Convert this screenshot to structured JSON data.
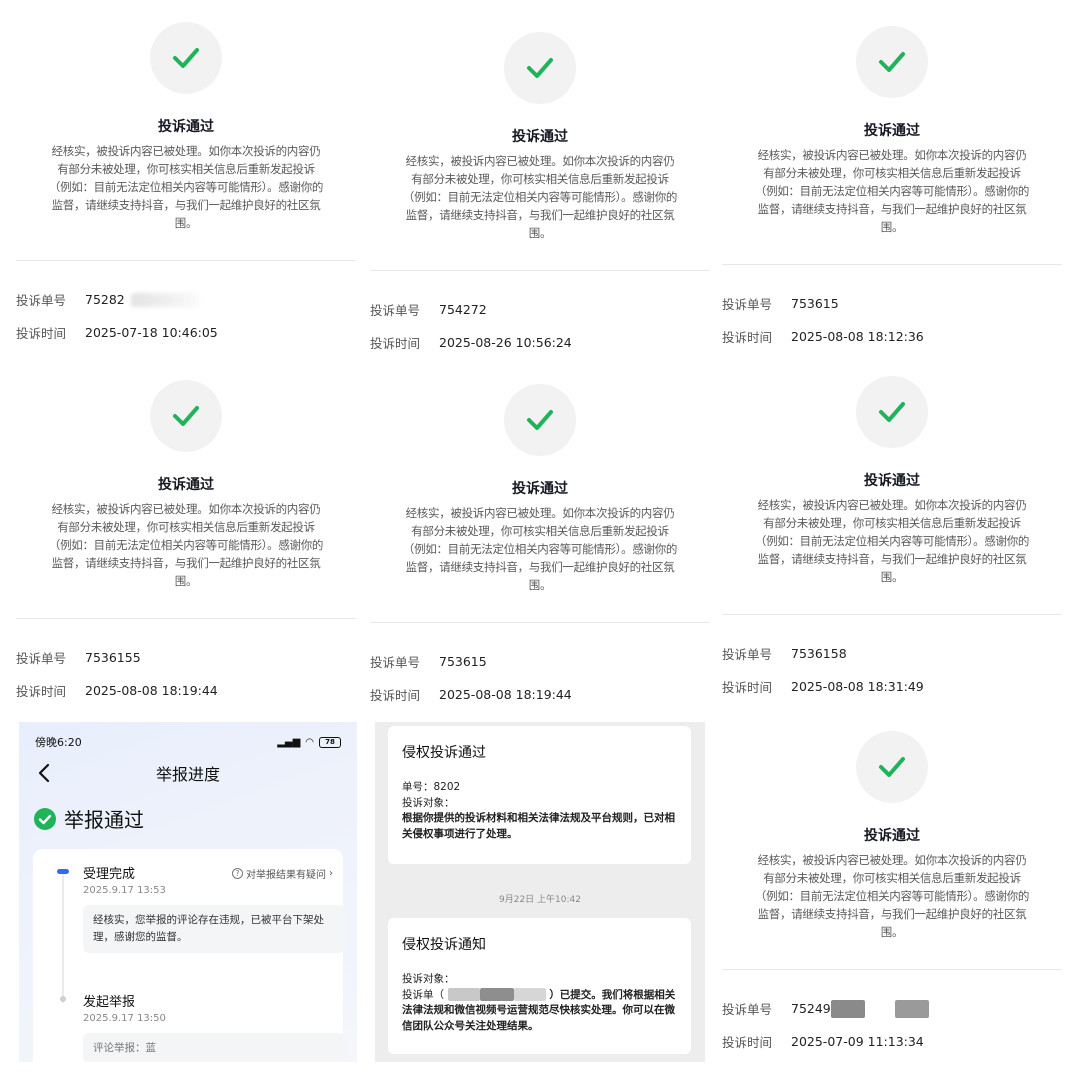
{
  "complaint_cards": [
    {
      "title": "投诉通过",
      "desc_lines": [
        "经核实，被投诉内容已被处理。如你本次投诉的内容仍",
        "有部分未被处理，你可核实相关信息后重新发起投诉",
        "（例如：目前无法定位相关内容等可能情形）。感谢你的",
        "监督，请继续支持抖音，与我们一起维护良好的社区氛",
        "围。"
      ],
      "id_label": "投诉单号",
      "id_value": "75282",
      "time_label": "投诉时间",
      "time_value": "2025-07-18 10:46:05"
    },
    {
      "title": "投诉通过",
      "desc_lines": [
        "经核实，被投诉内容已被处理。如你本次投诉的内容仍",
        "有部分未被处理，你可核实相关信息后重新发起投诉",
        "（例如：目前无法定位相关内容等可能情形）。感谢你的",
        "监督，请继续支持抖音，与我们一起维护良好的社区氛",
        "围。"
      ],
      "id_label": "投诉单号",
      "id_value": "754272",
      "time_label": "投诉时间",
      "time_value": "2025-08-26 10:56:24"
    },
    {
      "title": "投诉通过",
      "desc_lines": [
        "经核实，被投诉内容已被处理。如你本次投诉的内容仍",
        "有部分未被处理，你可核实相关信息后重新发起投诉",
        "（例如：目前无法定位相关内容等可能情形）。感谢你的",
        "监督，请继续支持抖音，与我们一起维护良好的社区氛",
        "围。"
      ],
      "id_label": "投诉单号",
      "id_value": "753615",
      "time_label": "投诉时间",
      "time_value": "2025-08-08 18:12:36"
    },
    {
      "title": "投诉通过",
      "desc_lines": [
        "经核实，被投诉内容已被处理。如你本次投诉的内容仍",
        "有部分未被处理，你可核实相关信息后重新发起投诉",
        "（例如：目前无法定位相关内容等可能情形）。感谢你的",
        "监督，请继续支持抖音，与我们一起维护良好的社区氛",
        "围。"
      ],
      "id_label": "投诉单号",
      "id_value": "7536155",
      "time_label": "投诉时间",
      "time_value": "2025-08-08 18:19:44"
    },
    {
      "title": "投诉通过",
      "desc_lines": [
        "经核实，被投诉内容已被处理。如你本次投诉的内容仍",
        "有部分未被处理，你可核实相关信息后重新发起投诉",
        "（例如：目前无法定位相关内容等可能情形）。感谢你的",
        "监督，请继续支持抖音，与我们一起维护良好的社区氛",
        "围。"
      ],
      "id_label": "投诉单号",
      "id_value": "753615",
      "time_label": "投诉时间",
      "time_value": "2025-08-08 18:19:44"
    },
    {
      "title": "投诉通过",
      "desc_lines": [
        "经核实，被投诉内容已被处理。如你本次投诉的内容仍",
        "有部分未被处理，你可核实相关信息后重新发起投诉",
        "（例如：目前无法定位相关内容等可能情形）。感谢你的",
        "监督，请继续支持抖音，与我们一起维护良好的社区氛",
        "围。"
      ],
      "id_label": "投诉单号",
      "id_value": "7536158",
      "time_label": "投诉时间",
      "time_value": "2025-08-08 18:31:49"
    },
    {
      "title": "投诉通过",
      "desc_lines": [
        "经核实，被投诉内容已被处理。如你本次投诉的内容仍",
        "有部分未被处理，你可核实相关信息后重新发起投诉",
        "（例如：目前无法定位相关内容等可能情形）。感谢你的",
        "监督，请继续支持抖音，与我们一起维护良好的社区氛",
        "围。"
      ],
      "id_label": "投诉单号",
      "id_value": "75249",
      "time_label": "投诉时间",
      "time_value": "2025-07-09 11:13:34"
    }
  ],
  "report": {
    "status_time": "傍晚6:20",
    "battery": "78",
    "nav_title": "举报进度",
    "passed_text": "举报通过",
    "step1_title": "受理完成",
    "step1_date": "2025.9.17 13:53",
    "query_link": "对举报结果有疑问",
    "step1_detail": "经核实，您举报的评论存在违规，已被平台下架处理，感谢您的监督。",
    "step2_title": "发起举报",
    "step2_date": "2025.9.17 13:50",
    "step2_detail": "评论举报：蓝"
  },
  "wechat": {
    "card1_title": "侵权投诉通过",
    "card1_id": "单号：8202",
    "card1_target": "投诉对象：",
    "card1_text": "根据你提供的投诉材料和相关法律法规及平台规则，已对相关侵权事项进行了处理。",
    "time": "9月22日 上午10:42",
    "card2_title": "侵权投诉通知",
    "card2_target": "投诉对象：",
    "card2_text_a": "投诉单（",
    "card2_text_b": "）已提交。我们将根据相关法律法规和微信视频号运营规范尽快核实处理。你可以在微信团队公众号关注处理结果。"
  },
  "colors": {
    "check_green": "#1fb35a",
    "accent_blue": "#2f6cf5"
  }
}
